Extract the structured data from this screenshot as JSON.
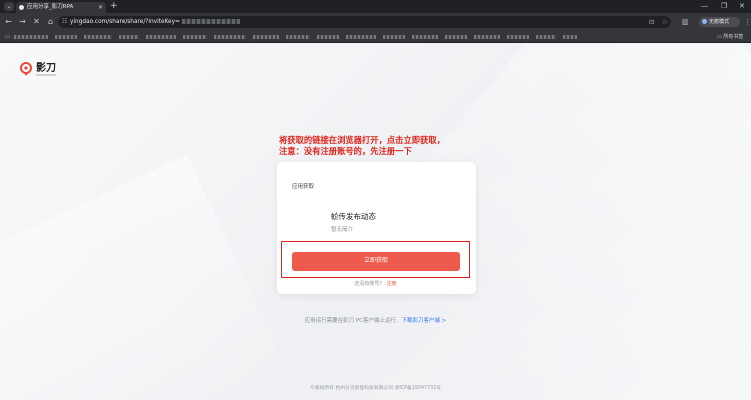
{
  "browser": {
    "tab_title": "应用分享_影刀RPA",
    "tab_switcher": "⌄",
    "new_tab": "+",
    "url": "yingdao.com/share/share/?inviteKey=",
    "profile_label": "无痕模式",
    "bookmarks_all": "所有书签"
  },
  "page": {
    "logo_text": "影刀",
    "annotation_line1": "将获取的链接在浏览器打开，点击立即获取，",
    "annotation_line2": "注意：没有注册账号的，先注册一下",
    "card": {
      "header": "应用获取",
      "app_name": "蚧传发布动态",
      "app_desc": "暂无简介",
      "button_label": "立即获取",
      "register_prompt": "还没有账号?",
      "register_link": "注册"
    },
    "hint_text": "应用运行需要在影刀 PC客户端上运行,",
    "hint_link": "下载影刀客户端 >",
    "footer": "©版权所有 杭州分叉智能科技有限公司 浙ICP备19047732号"
  },
  "colors": {
    "brand_red": "#ee5b4c",
    "annotation_red": "#e0231b",
    "link_blue": "#3b79f0"
  }
}
